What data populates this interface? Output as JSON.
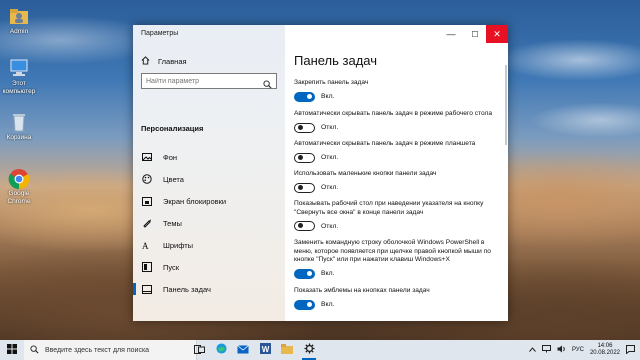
{
  "desktop": {
    "icons": [
      {
        "label": "Admin",
        "icon": "user-folder-icon"
      },
      {
        "label": "Этот компьютер",
        "icon": "computer-icon"
      },
      {
        "label": "Корзина",
        "icon": "recycle-bin-icon"
      },
      {
        "label": "Google Chrome",
        "icon": "chrome-icon"
      }
    ]
  },
  "window": {
    "title": "Параметры",
    "controls": {
      "minimize": "—",
      "maximize": "☐",
      "close": "✕"
    }
  },
  "sidebar": {
    "home_label": "Главная",
    "search_placeholder": "Найти параметр",
    "section_label": "Персонализация",
    "items": [
      {
        "label": "Фон",
        "icon": "image-icon"
      },
      {
        "label": "Цвета",
        "icon": "palette-icon"
      },
      {
        "label": "Экран блокировки",
        "icon": "lock-screen-icon"
      },
      {
        "label": "Темы",
        "icon": "themes-icon"
      },
      {
        "label": "Шрифты",
        "icon": "fonts-icon"
      },
      {
        "label": "Пуск",
        "icon": "start-icon"
      },
      {
        "label": "Панель задач",
        "icon": "taskbar-icon",
        "active": true
      }
    ]
  },
  "content": {
    "title": "Панель задач",
    "settings": [
      {
        "label": "Закрепить панель задач",
        "state": "on",
        "state_label": "Вкл."
      },
      {
        "label": "Автоматически скрывать панель задач в режиме рабочего стола",
        "state": "off",
        "state_label": "Откл."
      },
      {
        "label": "Автоматически скрывать панель задач в режиме планшета",
        "state": "off",
        "state_label": "Откл."
      },
      {
        "label": "Использовать маленькие кнопки панели задач",
        "state": "off",
        "state_label": "Откл."
      },
      {
        "label": "Показывать рабочий стол при наведении указателя на кнопку \"Свернуть все окна\" в конце панели задач",
        "state": "off",
        "state_label": "Откл."
      },
      {
        "label": "Заменить командную строку оболочкой Windows PowerShell в меню, которое появляется при щелчке правой кнопкой мыши по кнопке \"Пуск\" или при нажатии клавиш Windows+X",
        "state": "on",
        "state_label": "Вкл."
      },
      {
        "label": "Показать эмблемы на кнопках панели задач",
        "state": "on",
        "state_label": "Вкл."
      }
    ]
  },
  "taskbar": {
    "search_placeholder": "Введите здесь текст для поиска",
    "language": "РУС",
    "time": "14:06",
    "date": "20.08.2022",
    "accent": "#0067c0"
  }
}
